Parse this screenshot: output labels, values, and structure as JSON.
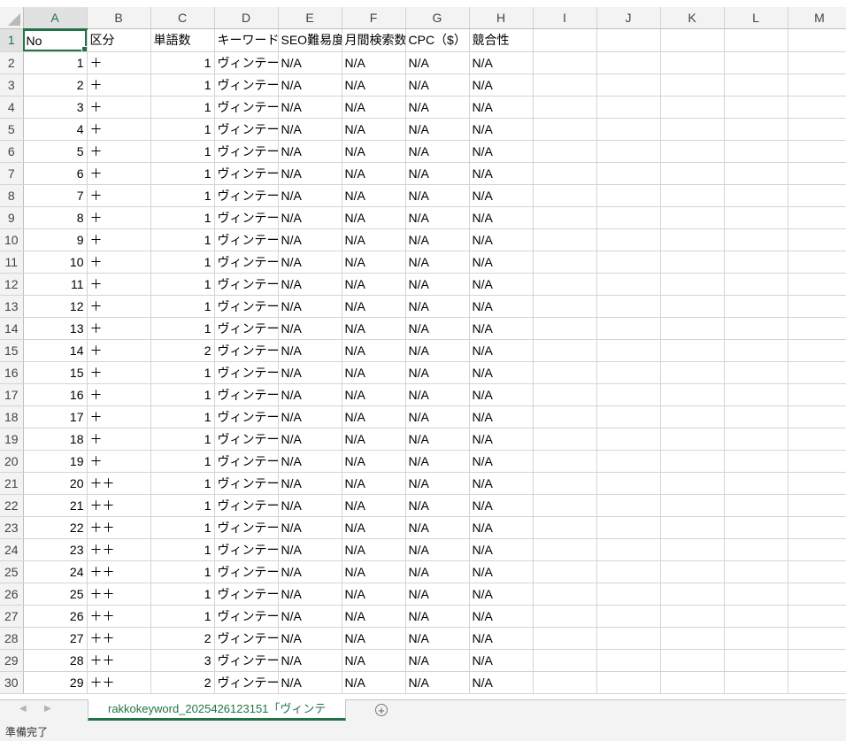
{
  "sheet": {
    "columns": [
      "A",
      "B",
      "C",
      "D",
      "E",
      "F",
      "G",
      "H",
      "I",
      "J",
      "K",
      "L",
      "M"
    ],
    "active_column": "A",
    "active_row": 1,
    "header_row": [
      "No",
      "区分",
      "単語数",
      "キーワード",
      "SEO難易度",
      "月間検索数",
      "CPC（$）",
      "競合性"
    ],
    "rows": [
      {
        "no": "1",
        "kubun": "＋",
        "words": "1",
        "keyword": "ヴィンテージ",
        "seo": "N/A",
        "monthly": "N/A",
        "cpc": "N/A",
        "comp": "N/A"
      },
      {
        "no": "2",
        "kubun": "＋",
        "words": "1",
        "keyword": "ヴィンテージ",
        "seo": "N/A",
        "monthly": "N/A",
        "cpc": "N/A",
        "comp": "N/A"
      },
      {
        "no": "3",
        "kubun": "＋",
        "words": "1",
        "keyword": "ヴィンテージ",
        "seo": "N/A",
        "monthly": "N/A",
        "cpc": "N/A",
        "comp": "N/A"
      },
      {
        "no": "4",
        "kubun": "＋",
        "words": "1",
        "keyword": "ヴィンテージ",
        "seo": "N/A",
        "monthly": "N/A",
        "cpc": "N/A",
        "comp": "N/A"
      },
      {
        "no": "5",
        "kubun": "＋",
        "words": "1",
        "keyword": "ヴィンテージ",
        "seo": "N/A",
        "monthly": "N/A",
        "cpc": "N/A",
        "comp": "N/A"
      },
      {
        "no": "6",
        "kubun": "＋",
        "words": "1",
        "keyword": "ヴィンテージ",
        "seo": "N/A",
        "monthly": "N/A",
        "cpc": "N/A",
        "comp": "N/A"
      },
      {
        "no": "7",
        "kubun": "＋",
        "words": "1",
        "keyword": "ヴィンテージ",
        "seo": "N/A",
        "monthly": "N/A",
        "cpc": "N/A",
        "comp": "N/A"
      },
      {
        "no": "8",
        "kubun": "＋",
        "words": "1",
        "keyword": "ヴィンテージ",
        "seo": "N/A",
        "monthly": "N/A",
        "cpc": "N/A",
        "comp": "N/A"
      },
      {
        "no": "9",
        "kubun": "＋",
        "words": "1",
        "keyword": "ヴィンテージ",
        "seo": "N/A",
        "monthly": "N/A",
        "cpc": "N/A",
        "comp": "N/A"
      },
      {
        "no": "10",
        "kubun": "＋",
        "words": "1",
        "keyword": "ヴィンテージ",
        "seo": "N/A",
        "monthly": "N/A",
        "cpc": "N/A",
        "comp": "N/A"
      },
      {
        "no": "11",
        "kubun": "＋",
        "words": "1",
        "keyword": "ヴィンテージ",
        "seo": "N/A",
        "monthly": "N/A",
        "cpc": "N/A",
        "comp": "N/A"
      },
      {
        "no": "12",
        "kubun": "＋",
        "words": "1",
        "keyword": "ヴィンテージ",
        "seo": "N/A",
        "monthly": "N/A",
        "cpc": "N/A",
        "comp": "N/A"
      },
      {
        "no": "13",
        "kubun": "＋",
        "words": "1",
        "keyword": "ヴィンテージ",
        "seo": "N/A",
        "monthly": "N/A",
        "cpc": "N/A",
        "comp": "N/A"
      },
      {
        "no": "14",
        "kubun": "＋",
        "words": "2",
        "keyword": "ヴィンテージ",
        "seo": "N/A",
        "monthly": "N/A",
        "cpc": "N/A",
        "comp": "N/A"
      },
      {
        "no": "15",
        "kubun": "＋",
        "words": "1",
        "keyword": "ヴィンテージ",
        "seo": "N/A",
        "monthly": "N/A",
        "cpc": "N/A",
        "comp": "N/A"
      },
      {
        "no": "16",
        "kubun": "＋",
        "words": "1",
        "keyword": "ヴィンテージ",
        "seo": "N/A",
        "monthly": "N/A",
        "cpc": "N/A",
        "comp": "N/A"
      },
      {
        "no": "17",
        "kubun": "＋",
        "words": "1",
        "keyword": "ヴィンテージ",
        "seo": "N/A",
        "monthly": "N/A",
        "cpc": "N/A",
        "comp": "N/A"
      },
      {
        "no": "18",
        "kubun": "＋",
        "words": "1",
        "keyword": "ヴィンテージ",
        "seo": "N/A",
        "monthly": "N/A",
        "cpc": "N/A",
        "comp": "N/A"
      },
      {
        "no": "19",
        "kubun": "＋",
        "words": "1",
        "keyword": "ヴィンテージ",
        "seo": "N/A",
        "monthly": "N/A",
        "cpc": "N/A",
        "comp": "N/A"
      },
      {
        "no": "20",
        "kubun": "＋＋",
        "words": "1",
        "keyword": "ヴィンテージ",
        "seo": "N/A",
        "monthly": "N/A",
        "cpc": "N/A",
        "comp": "N/A"
      },
      {
        "no": "21",
        "kubun": "＋＋",
        "words": "1",
        "keyword": "ヴィンテージ",
        "seo": "N/A",
        "monthly": "N/A",
        "cpc": "N/A",
        "comp": "N/A"
      },
      {
        "no": "22",
        "kubun": "＋＋",
        "words": "1",
        "keyword": "ヴィンテージ",
        "seo": "N/A",
        "monthly": "N/A",
        "cpc": "N/A",
        "comp": "N/A"
      },
      {
        "no": "23",
        "kubun": "＋＋",
        "words": "1",
        "keyword": "ヴィンテージ",
        "seo": "N/A",
        "monthly": "N/A",
        "cpc": "N/A",
        "comp": "N/A"
      },
      {
        "no": "24",
        "kubun": "＋＋",
        "words": "1",
        "keyword": "ヴィンテージ",
        "seo": "N/A",
        "monthly": "N/A",
        "cpc": "N/A",
        "comp": "N/A"
      },
      {
        "no": "25",
        "kubun": "＋＋",
        "words": "1",
        "keyword": "ヴィンテージ",
        "seo": "N/A",
        "monthly": "N/A",
        "cpc": "N/A",
        "comp": "N/A"
      },
      {
        "no": "26",
        "kubun": "＋＋",
        "words": "1",
        "keyword": "ヴィンテージ",
        "seo": "N/A",
        "monthly": "N/A",
        "cpc": "N/A",
        "comp": "N/A"
      },
      {
        "no": "27",
        "kubun": "＋＋",
        "words": "2",
        "keyword": "ヴィンテージ",
        "seo": "N/A",
        "monthly": "N/A",
        "cpc": "N/A",
        "comp": "N/A"
      },
      {
        "no": "28",
        "kubun": "＋＋",
        "words": "3",
        "keyword": "ヴィンテージ",
        "seo": "N/A",
        "monthly": "N/A",
        "cpc": "N/A",
        "comp": "N/A"
      },
      {
        "no": "29",
        "kubun": "＋＋",
        "words": "2",
        "keyword": "ヴィンテージ",
        "seo": "N/A",
        "monthly": "N/A",
        "cpc": "N/A",
        "comp": "N/A"
      }
    ]
  },
  "tabs": {
    "active_sheet_label": "rakkokeyword_2025426123151「ヴィンテ",
    "prev_icon": "◀",
    "next_icon": "▶",
    "add_icon": "+"
  },
  "status": {
    "text": "準備完了"
  },
  "colors": {
    "accent": "#217346",
    "header_bg": "#f3f3f3",
    "gridline": "#d4d4d4"
  }
}
